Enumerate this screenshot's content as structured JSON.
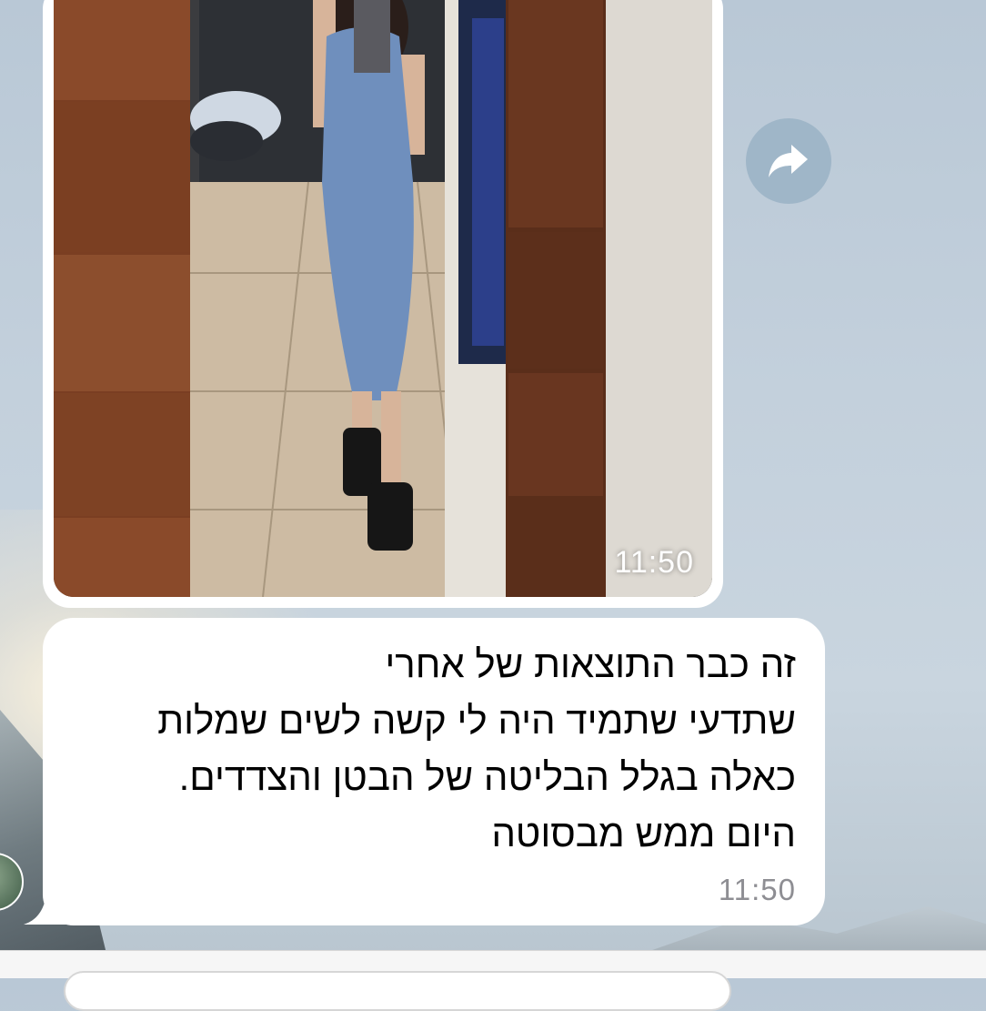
{
  "photo_message": {
    "time": "11:50",
    "image": "mirror-selfie-blue-dress-photo"
  },
  "share_button": {
    "icon": "share-arrow-icon"
  },
  "text_message": {
    "lines": [
      "זה כבר התוצאות של אחרי",
      "שתדעי שתמיד היה לי קשה לשים שמלות",
      "כאלה בגלל הבליטה של הבטן והצדדים.",
      "היום ממש מבסוטה"
    ],
    "time": "11:50"
  },
  "colors": {
    "bubble": "#ffffff",
    "time_gray": "#8e8e93",
    "share_bg": "#9fb6c8"
  }
}
